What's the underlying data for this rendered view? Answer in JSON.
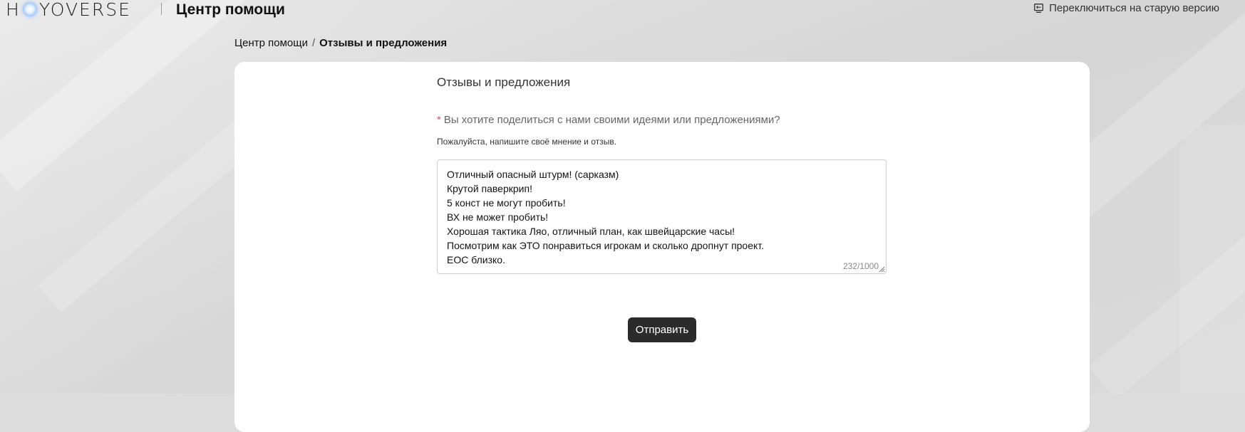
{
  "header": {
    "logo_left": "H",
    "logo_right": "YOVERSE",
    "title": "Центр помощи",
    "switch_label": "Переключиться на старую версию"
  },
  "breadcrumb": {
    "home": "Центр помощи",
    "separator": "/",
    "current": "Отзывы и предложения"
  },
  "form": {
    "title": "Отзывы и предложения",
    "required_mark": "*",
    "question": "Вы хотите поделиться с нами своими идеями или предложениями?",
    "hint": "Пожалуйста, напишите своё мнение и отзыв.",
    "feedback_text": "Отличный опасный штурм! (сарказм)\nКрутой паверкрип!\n5 конст не могут пробить!\nВХ не может пробить!\nХорошая тактика Ляо, отличный план, как швейцарские часы!\nПосмотрим как ЭТО понравиться игрокам и сколько дропнут проект.\nЕОС близко.",
    "counter": "232/1000",
    "submit_label": "Отправить"
  },
  "colors": {
    "accent_button": "#2b2b2b",
    "required": "#e4514b",
    "card_bg": "#ffffff",
    "page_bg": "#dcdcdc"
  }
}
